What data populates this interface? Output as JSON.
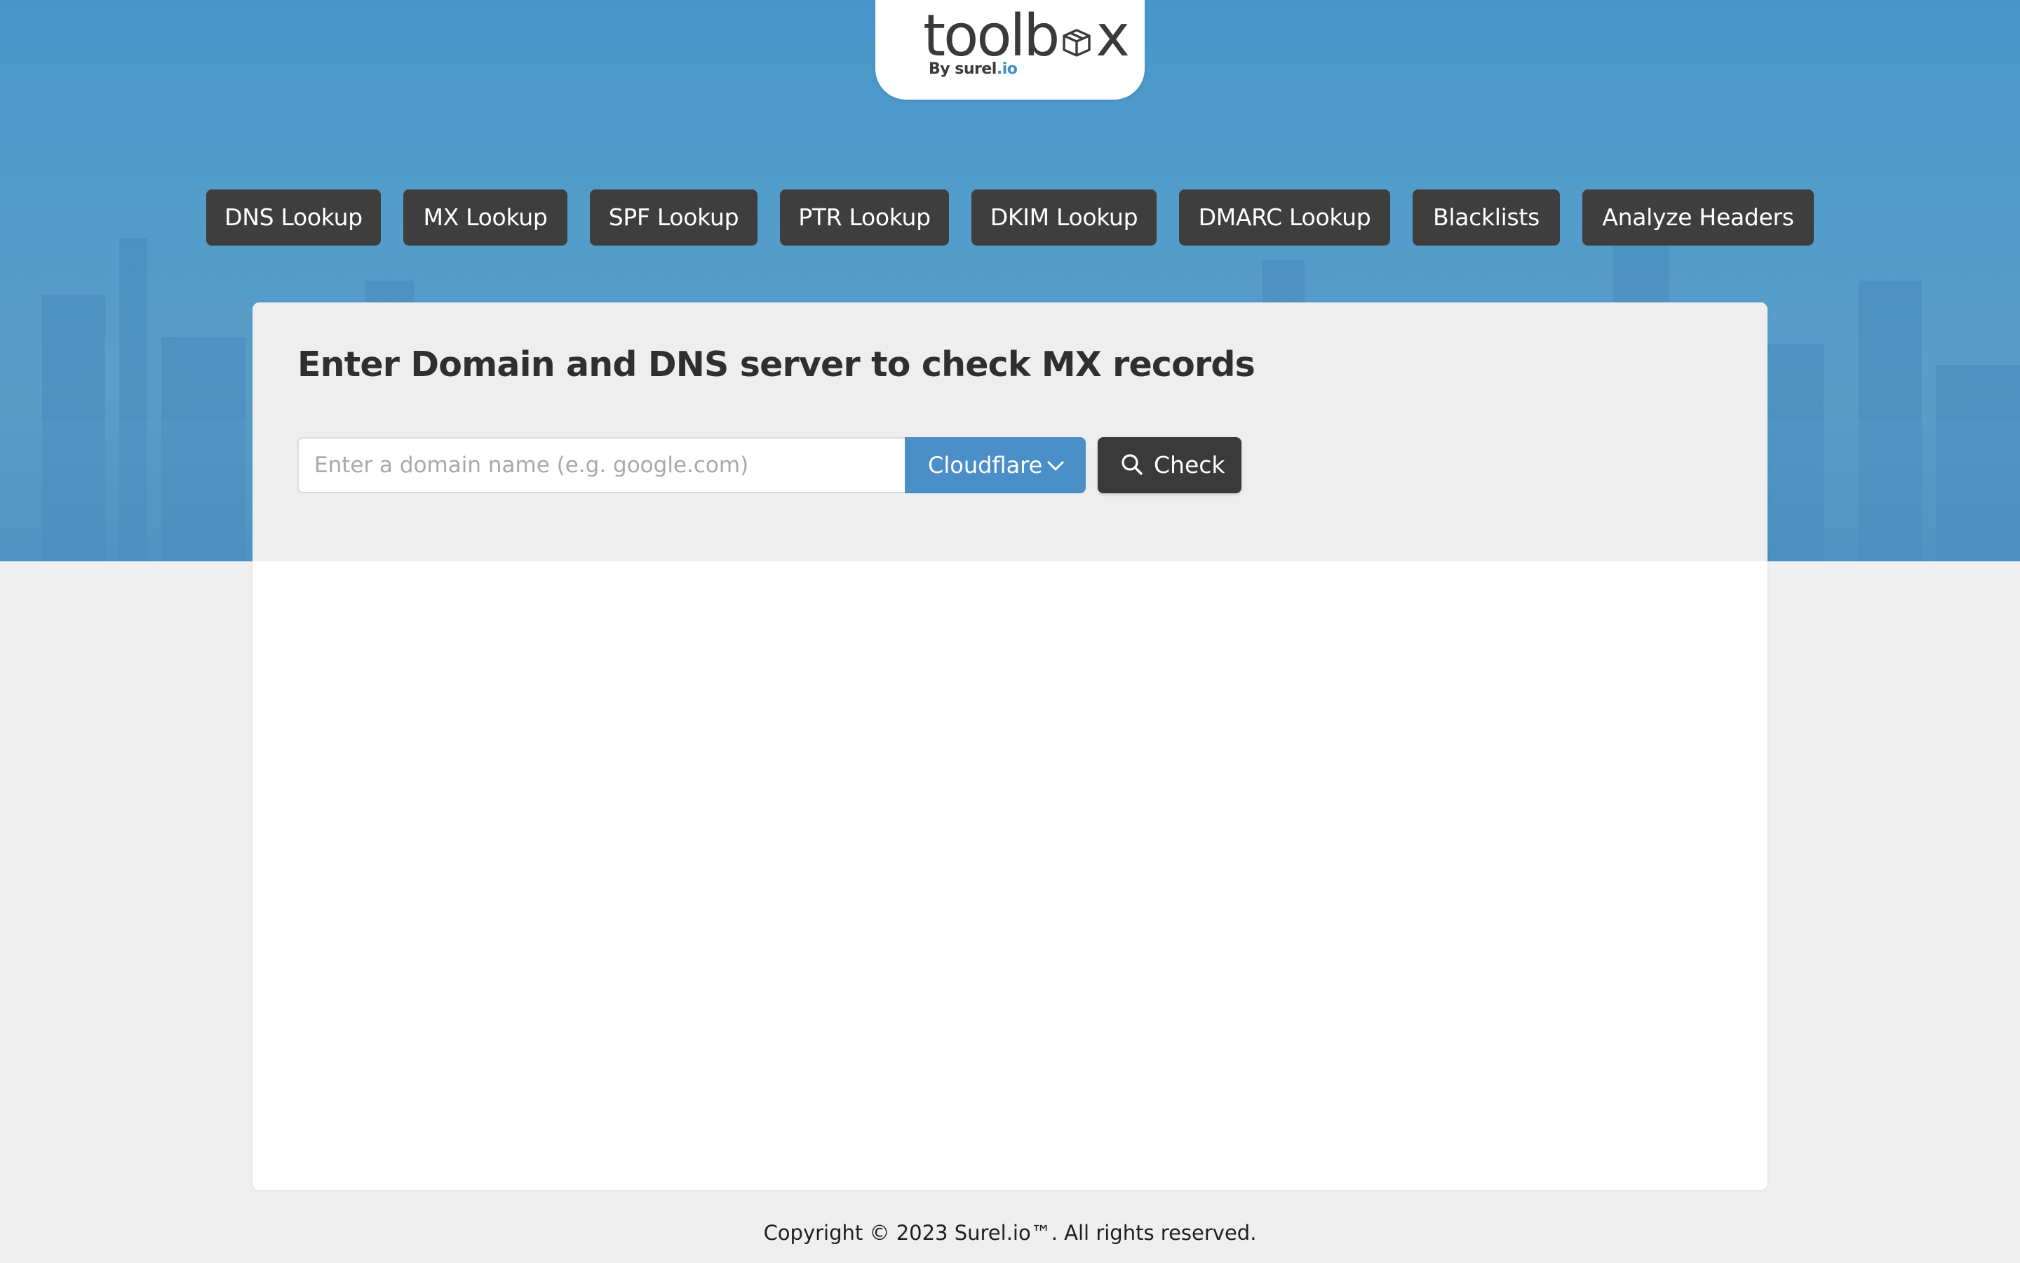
{
  "logo": {
    "word_start": "toolb",
    "word_end": "x",
    "sub_by": "By surel",
    "sub_io": ".io",
    "box_icon": "package-box-icon"
  },
  "nav": {
    "items": [
      {
        "label": "DNS Lookup"
      },
      {
        "label": "MX Lookup"
      },
      {
        "label": "SPF Lookup"
      },
      {
        "label": "PTR Lookup"
      },
      {
        "label": "DKIM Lookup"
      },
      {
        "label": "DMARC Lookup"
      },
      {
        "label": "Blacklists"
      },
      {
        "label": "Analyze Headers"
      }
    ]
  },
  "form": {
    "title": "Enter Domain and DNS server to check MX records",
    "domain_placeholder": "Enter a domain name (e.g. google.com)",
    "domain_value": "",
    "dns_server": "Cloudflare",
    "check_label": "Check"
  },
  "footer": {
    "text": "Copyright © 2023 Surel.io™. All rights reserved."
  },
  "colors": {
    "hero_blue": "#4592c7",
    "button_dark": "#3e3e3e",
    "select_blue": "#4a8fc8",
    "page_bg": "#efefef",
    "brand_accent": "#3f8fcf"
  }
}
